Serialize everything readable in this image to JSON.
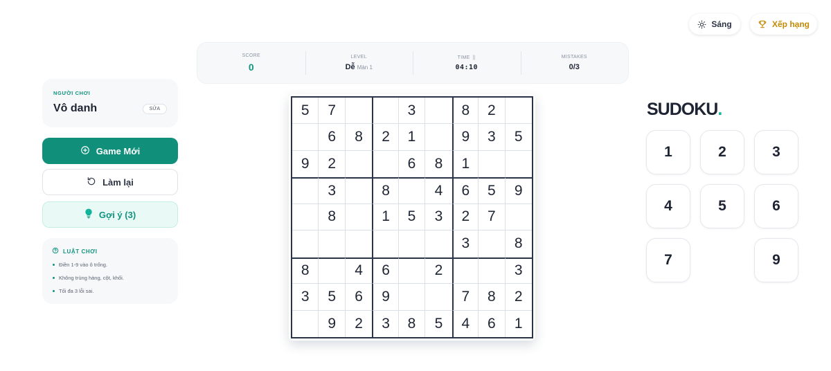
{
  "header": {
    "theme_label": "Sáng",
    "theme_icon": "sun-icon",
    "rank_label": "Xếp hạng",
    "rank_icon": "trophy-icon",
    "rank_color": "#c58a07"
  },
  "stats": {
    "score_label": "SCORE",
    "score_value": "0",
    "level_label": "LEVEL",
    "level_value": "Dễ",
    "level_sub": "Màn 1",
    "time_label": "TIME",
    "time_value": "04:10",
    "mistakes_label": "MISTAKES",
    "mistakes_value": "0/3"
  },
  "player": {
    "label": "NGƯỜI CHƠI",
    "name": "Vô danh",
    "edit_label": "SỬA"
  },
  "actions": {
    "new_game": "Game Mới",
    "reset": "Làm lại",
    "hint": "Gợi ý (3)"
  },
  "rules": {
    "title": "LUẬT CHƠI",
    "items": [
      "Điền 1-9 vào ô trống.",
      "Không trùng hàng, cột, khối.",
      "Tối đa 3 lỗi sai."
    ]
  },
  "board": [
    [
      "5",
      "7",
      "",
      "",
      "3",
      "",
      "8",
      "2",
      ""
    ],
    [
      "",
      "6",
      "8",
      "2",
      "1",
      "",
      "9",
      "3",
      "5"
    ],
    [
      "9",
      "2",
      "",
      "",
      "6",
      "8",
      "1",
      "",
      ""
    ],
    [
      "",
      "3",
      "",
      "8",
      "",
      "4",
      "6",
      "5",
      "9"
    ],
    [
      "",
      "8",
      "",
      "1",
      "5",
      "3",
      "2",
      "7",
      ""
    ],
    [
      "",
      "",
      "",
      "",
      "",
      "",
      "3",
      "",
      "8"
    ],
    [
      "8",
      "",
      "4",
      "6",
      "",
      "2",
      "",
      "",
      "3"
    ],
    [
      "3",
      "5",
      "6",
      "9",
      "",
      "",
      "7",
      "8",
      "2"
    ],
    [
      "",
      "9",
      "2",
      "3",
      "8",
      "5",
      "4",
      "6",
      "1"
    ]
  ],
  "brand": {
    "title": "SUDOKU",
    "dot": ".",
    "accent": "#12b39a"
  },
  "numpad": [
    "1",
    "2",
    "3",
    "4",
    "5",
    "6",
    "7",
    "",
    "9"
  ],
  "colors": {
    "primary": "#10907b",
    "grid": "#2a3448"
  }
}
